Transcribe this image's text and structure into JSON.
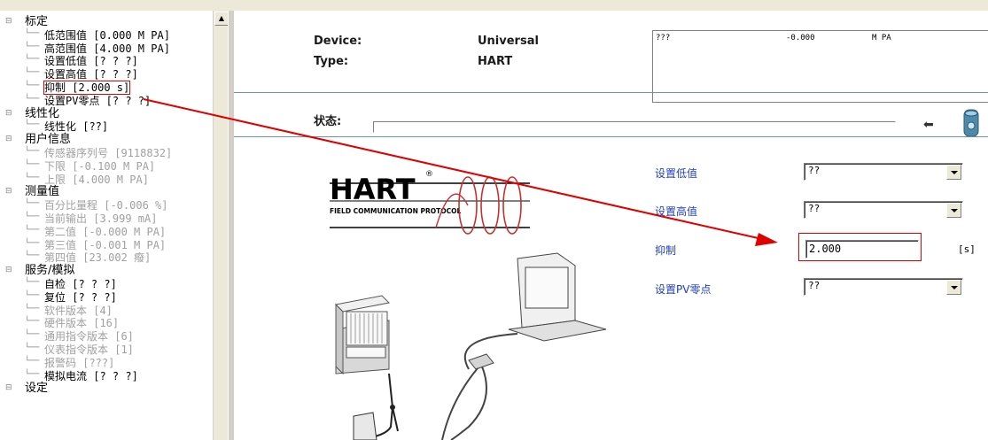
{
  "tree": {
    "items": [
      {
        "label": "标定",
        "type": "category"
      },
      {
        "label": "低范围值  [0.000 M PA]",
        "type": "item"
      },
      {
        "label": "高范围值  [4.000 M PA]",
        "type": "item"
      },
      {
        "label": "设置低值  [? ? ?]",
        "type": "item"
      },
      {
        "label": "设置高值  [? ? ?]",
        "type": "item"
      },
      {
        "label": "抑制  [2.000 s]",
        "type": "item",
        "highlighted": true
      },
      {
        "label": "设置PV零点  [? ? ?]",
        "type": "item"
      },
      {
        "label": "线性化",
        "type": "category"
      },
      {
        "label": "线性化  [??]",
        "type": "item"
      },
      {
        "label": "用户信息",
        "type": "category"
      },
      {
        "label": "传感器序列号  [9118832]",
        "type": "disabled"
      },
      {
        "label": "下限  [-0.100 M PA]",
        "type": "disabled"
      },
      {
        "label": "上限  [4.000 M PA]",
        "type": "disabled"
      },
      {
        "label": "测量值",
        "type": "category"
      },
      {
        "label": "百分比量程  [-0.006 %]",
        "type": "disabled"
      },
      {
        "label": "当前输出  [3.999 mA]",
        "type": "disabled"
      },
      {
        "label": "第二值  [-0.000 M PA]",
        "type": "disabled"
      },
      {
        "label": "第三值  [-0.001 M PA]",
        "type": "disabled"
      },
      {
        "label": "第四值  [23.002 癈]",
        "type": "disabled"
      },
      {
        "label": "服务/模拟",
        "type": "category"
      },
      {
        "label": "自检  [? ? ?]",
        "type": "item"
      },
      {
        "label": "复位  [? ? ?]",
        "type": "item"
      },
      {
        "label": "软件版本  [4]",
        "type": "disabled"
      },
      {
        "label": "硬件版本  [16]",
        "type": "disabled"
      },
      {
        "label": "通用指令版本  [6]",
        "type": "disabled"
      },
      {
        "label": "仪表指令版本  [1]",
        "type": "disabled"
      },
      {
        "label": "报警码  [???]",
        "type": "disabled"
      },
      {
        "label": "模拟电流  [? ? ?]",
        "type": "item"
      },
      {
        "label": "设定",
        "type": "category"
      }
    ]
  },
  "header": {
    "device_label": "Device:",
    "device_value": "Universal",
    "type_label": "Type:",
    "type_value": "HART",
    "msg_q": "???",
    "msg_val": "-0.000",
    "msg_unit": "M PA"
  },
  "status": {
    "label": "状态:"
  },
  "logo": {
    "brand": "HART",
    "subtitle": "FIELD COMMUNICATION PROTOCOL",
    "reg": "®"
  },
  "fields": {
    "lower": {
      "label": "设置低值",
      "value": "??"
    },
    "upper": {
      "label": "设置高值",
      "value": "??"
    },
    "damping": {
      "label": "抑制",
      "value": "2.000",
      "unit": "[s]"
    },
    "pvzero": {
      "label": "设置PV零点",
      "value": "??"
    }
  },
  "colors": {
    "annotation": "#e00000",
    "field_label": "#1f3fbf",
    "separator": "#6f8fbf"
  },
  "icons": [
    "back-arrow-icon",
    "disk-icon",
    "scroll-up-icon"
  ]
}
